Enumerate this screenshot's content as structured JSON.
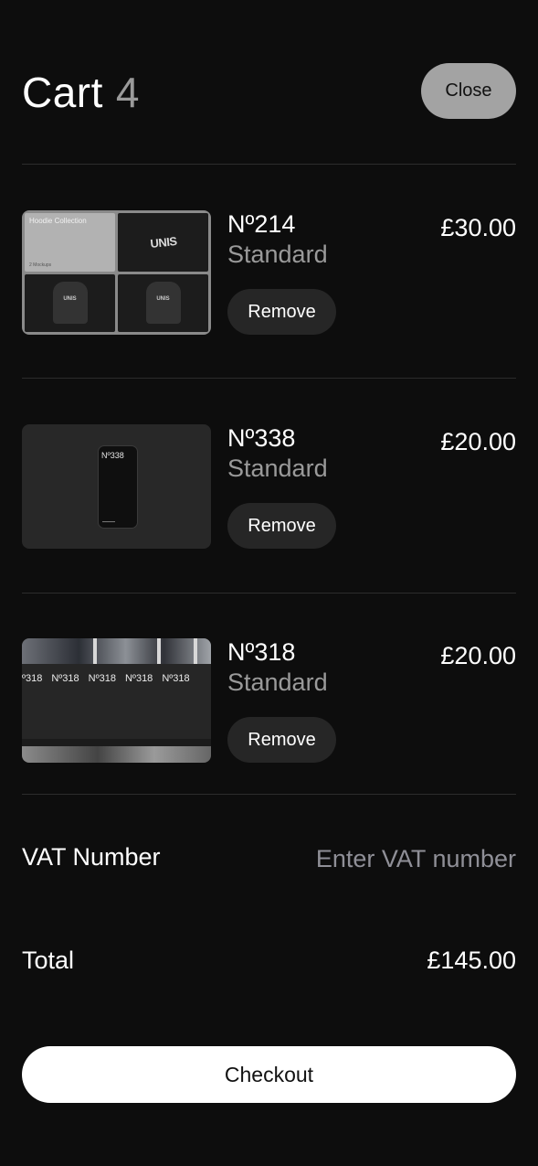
{
  "header": {
    "title": "Cart",
    "count": "4",
    "close_label": "Close"
  },
  "items": [
    {
      "name": "Nº214",
      "variant": "Standard",
      "price": "£30.00",
      "remove_label": "Remove",
      "thumb_title": "Hoodie Collection",
      "thumb_sub": "2 Mockups",
      "thumb_text": "UNIS"
    },
    {
      "name": "Nº338",
      "variant": "Standard",
      "price": "£20.00",
      "remove_label": "Remove",
      "thumb_text": "Nº338"
    },
    {
      "name": "Nº318",
      "variant": "Standard",
      "price": "£20.00",
      "remove_label": "Remove",
      "thumb_text": "Nº318"
    }
  ],
  "vat": {
    "label": "VAT Number",
    "value": "",
    "placeholder": "Enter VAT number"
  },
  "total": {
    "label": "Total",
    "value": "£145.00"
  },
  "checkout_label": "Checkout",
  "colors": {
    "background": "#0d0d0d",
    "close_button": "#a3a3a3",
    "remove_button": "#262626",
    "muted_text": "#9a9a9a",
    "checkout_button": "#ffffff"
  }
}
